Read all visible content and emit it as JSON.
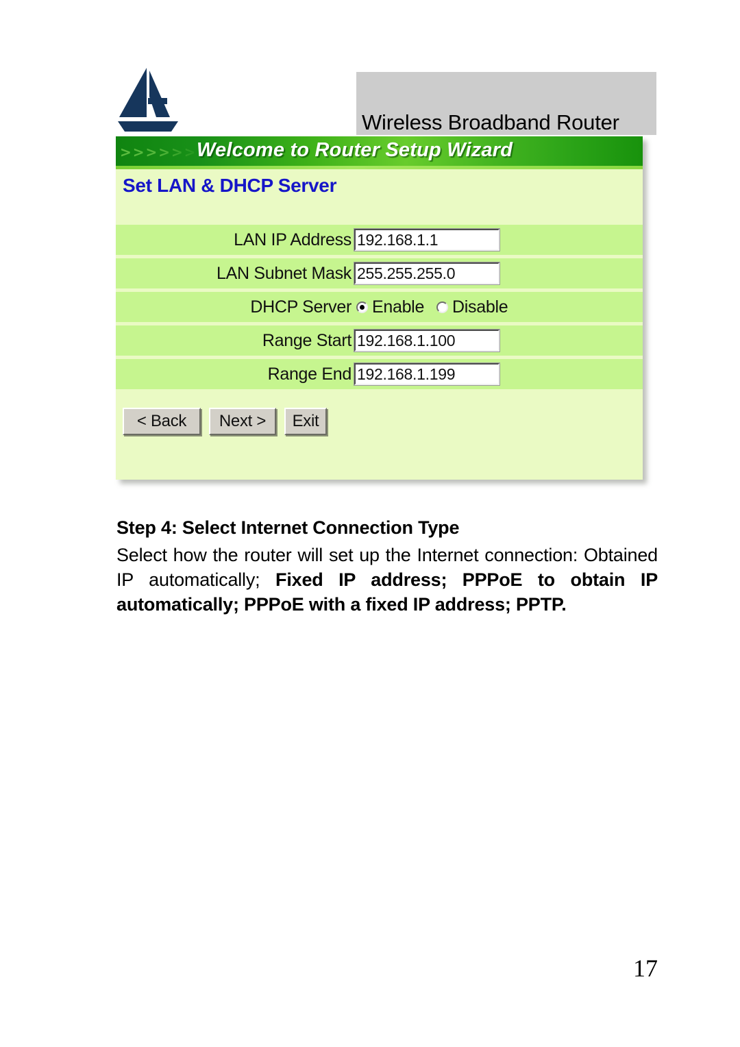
{
  "header": {
    "logo_name": "atlantis-sailboat-logo",
    "product_title": "Wireless Broadband Router"
  },
  "router_ui": {
    "banner": {
      "chevrons": ">>>>>>",
      "title": "Welcome to Router Setup Wizard"
    },
    "section_heading": "Set LAN & DHCP Server",
    "rows": [
      {
        "label": "LAN IP Address",
        "value": "192.168.1.1"
      },
      {
        "label": "LAN Subnet Mask",
        "value": "255.255.255.0"
      },
      {
        "label": "DHCP Server",
        "option_enable": "Enable",
        "option_disable": "Disable",
        "selected": "Enable"
      },
      {
        "label": "Range Start",
        "value": "192.168.1.100"
      },
      {
        "label": "Range End",
        "value": "192.168.1.199"
      }
    ],
    "buttons": {
      "back": "< Back",
      "next": "Next >",
      "exit": "Exit"
    },
    "colors": {
      "panel_bg": "#eafac4",
      "row_bg": "#c6f58f",
      "heading_blue": "#1616c8",
      "banner_green": "#108410",
      "button_face": "#d3d0c8"
    }
  },
  "document": {
    "step_heading": "Step 4: Select Internet Connection Type",
    "body": {
      "part1": "Select how the router will set up the Internet connection: Obtained IP automatically; ",
      "part2_bold": "Fixed IP address; PPPoE to obtain IP automatically; PPPoE with a fixed IP address; PPTP."
    },
    "page_number": "17"
  }
}
